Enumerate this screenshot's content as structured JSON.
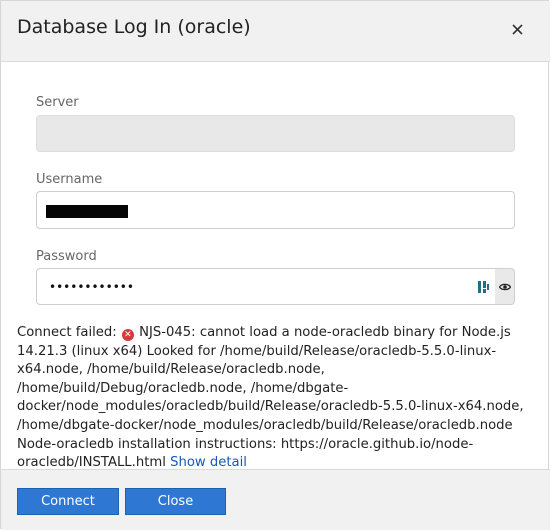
{
  "dialog": {
    "title": "Database Log In (oracle)",
    "close_icon": "close-icon"
  },
  "form": {
    "server": {
      "label": "Server",
      "value": ""
    },
    "username": {
      "label": "Username",
      "value": ""
    },
    "password": {
      "label": "Password",
      "value": "••••••••••••"
    }
  },
  "error": {
    "prefix": "Connect failed:",
    "code": "NJS-045:",
    "message": "cannot load a node-oracledb binary for Node.js 14.21.3 (linux x64) Looked for /home/build/Release/oracledb-5.5.0-linux-x64.node, /home/build/Release/oracledb.node, /home/build/Debug/oracledb.node, /home/dbgate-docker/node_modules/oracledb/build/Release/oracledb-5.5.0-linux-x64.node, /home/dbgate-docker/node_modules/oracledb/build/Release/oracledb.node Node-oracledb installation instructions: https://oracle.github.io/node-oracledb/INSTALL.html",
    "link": "Show detail"
  },
  "footer": {
    "connect_label": "Connect",
    "close_label": "Close"
  },
  "colors": {
    "accent": "#2e78d4",
    "error_icon": "#d83a3a",
    "link": "#1a57b8"
  }
}
